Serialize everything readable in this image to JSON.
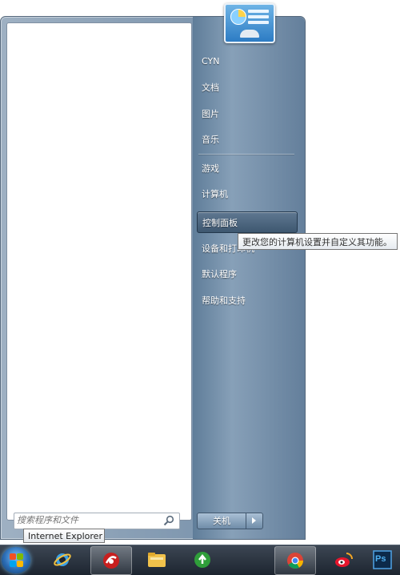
{
  "start_menu": {
    "right_items": [
      {
        "label": "CYN"
      },
      {
        "label": "文档"
      },
      {
        "label": "图片"
      },
      {
        "label": "音乐"
      },
      {
        "label": "游戏"
      },
      {
        "label": "计算机"
      },
      {
        "label": "控制面板",
        "hovered": true
      },
      {
        "label": "设备和打印机"
      },
      {
        "label": "默认程序"
      },
      {
        "label": "帮助和支持"
      }
    ],
    "tooltip": "更改您的计算机设置并自定义其功能。",
    "search": {
      "placeholder": "搜索程序和文件"
    },
    "shutdown_label": "关机"
  },
  "taskbar": {
    "hover_tooltip": "Internet Explorer",
    "items": [
      {
        "name": "internet-explorer",
        "icon": "ie-icon"
      },
      {
        "name": "app-red",
        "icon": "red-swirl-icon",
        "active": true
      },
      {
        "name": "file-explorer",
        "icon": "folder-icon"
      },
      {
        "name": "update-app",
        "icon": "green-arrow-icon"
      },
      {
        "name": "chrome",
        "icon": "chrome-icon",
        "active": true
      },
      {
        "name": "weibo",
        "icon": "weibo-icon"
      },
      {
        "name": "photoshop",
        "icon": "ps-icon",
        "label": "Ps"
      }
    ]
  },
  "colors": {
    "menu_frame": "#8aa0b6",
    "hover_item": "#4a637c",
    "taskbar": "#1d2530"
  }
}
